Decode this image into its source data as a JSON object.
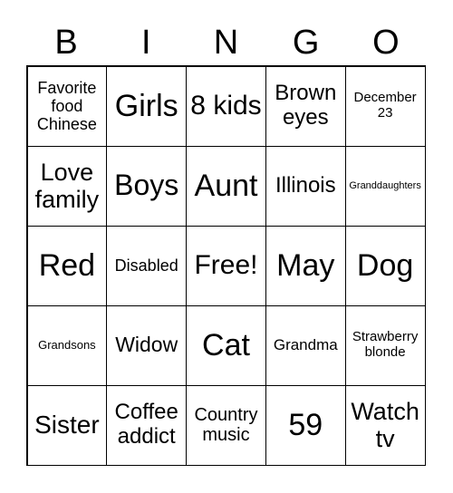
{
  "header": [
    "B",
    "I",
    "N",
    "G",
    "O"
  ],
  "cells": [
    "Favorite food Chinese",
    "Girls",
    "8 kids",
    "Brown eyes",
    "December 23",
    "Love family",
    "Boys",
    "Aunt",
    "Illinois",
    "Granddaughters",
    "Red",
    "Disabled",
    "Free!",
    "May",
    "Dog",
    "Grandsons",
    "Widow",
    "Cat",
    "Grandma",
    "Strawberry blonde",
    "Sister",
    "Coffee addict",
    "Country music",
    "59",
    "Watch tv"
  ]
}
